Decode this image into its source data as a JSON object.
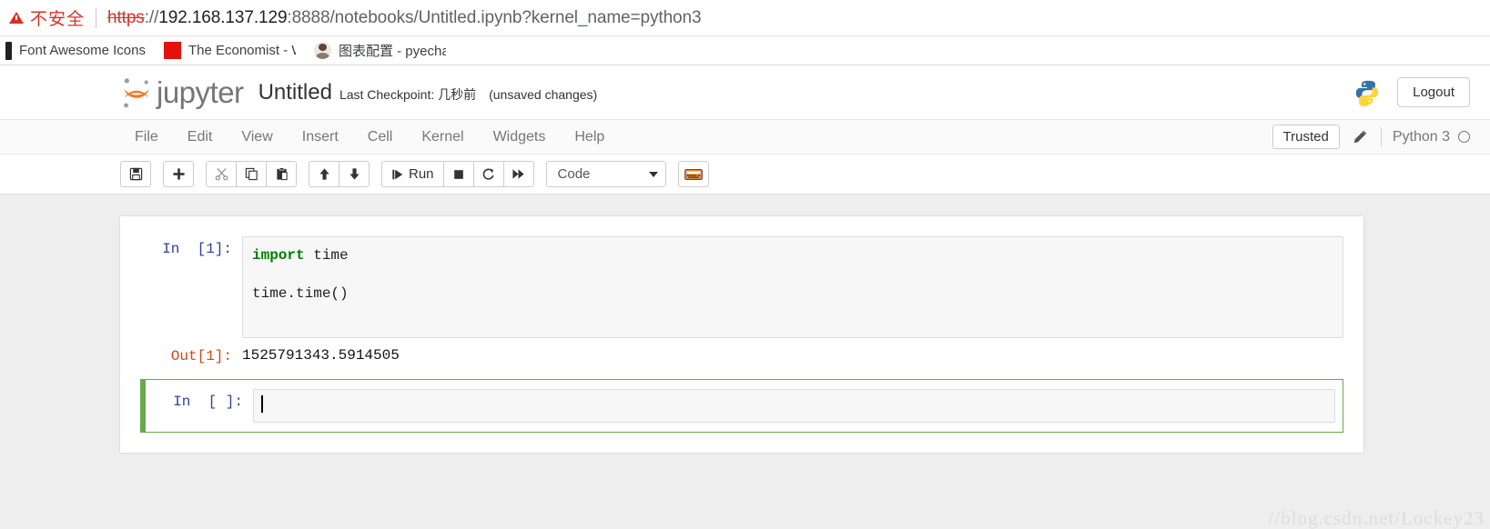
{
  "browser": {
    "security_label": "不安全",
    "security_icon": "warning-triangle-icon",
    "url": {
      "scheme": "https",
      "separator": "://",
      "host": "192.168.137.129",
      "rest": ":8888/notebooks/Untitled.ipynb?kernel_name=python3"
    },
    "bookmarks": [
      {
        "label": "Font Awesome Icons",
        "icon": "dark-bar-icon"
      },
      {
        "label": "The Economist - Wo",
        "icon": "red-square-icon"
      },
      {
        "label": "图表配置 - pyecharts",
        "icon": "avatar-icon"
      }
    ]
  },
  "header": {
    "logo_icon": "jupyter-logo-icon",
    "wordmark": "jupyter",
    "notebook_title": "Untitled",
    "checkpoint": "Last Checkpoint: 几秒前",
    "modified_state": "(unsaved changes)",
    "python_logo_icon": "python-logo-icon",
    "logout_label": "Logout"
  },
  "menubar": {
    "items": [
      {
        "label": "File"
      },
      {
        "label": "Edit"
      },
      {
        "label": "View"
      },
      {
        "label": "Insert"
      },
      {
        "label": "Cell"
      },
      {
        "label": "Kernel"
      },
      {
        "label": "Widgets"
      },
      {
        "label": "Help"
      }
    ],
    "trusted_label": "Trusted",
    "edit_icon": "pencil-icon",
    "kernel_name": "Python 3",
    "kernel_status_icon": "kernel-idle-circle-icon"
  },
  "toolbar": {
    "save_icon": "floppy-disk-icon",
    "insert_icon": "plus-icon",
    "cut_icon": "scissors-icon",
    "copy_icon": "copy-icon",
    "paste_icon": "paste-icon",
    "move_up_icon": "arrow-up-icon",
    "move_down_icon": "arrow-down-icon",
    "run_label": "Run",
    "run_icon": "run-icon",
    "stop_icon": "stop-square-icon",
    "restart_icon": "restart-circle-icon",
    "restart_run_all_icon": "fast-forward-icon",
    "cell_type": "Code",
    "cell_type_caret_icon": "chevron-down-icon",
    "command_palette_icon": "keyboard-icon"
  },
  "notebook": {
    "cells": [
      {
        "prompt": "In  [1]:",
        "code_line_1_keyword": "import",
        "code_line_1_rest": " time",
        "code_line_2": "time.time()"
      },
      {
        "prompt": "In  [ ]:",
        "code": ""
      }
    ],
    "output": {
      "prompt": "Out[1]:",
      "value": "1525791343.5914505"
    }
  },
  "watermark": "//blog.csdn.net/Lockey23",
  "colors": {
    "accent_orange": "#f37726",
    "selected_cell_green": "#6aa84f",
    "insecure_red": "#d93025",
    "in_prompt_blue": "#303f9f",
    "out_prompt_red": "#d84315"
  }
}
